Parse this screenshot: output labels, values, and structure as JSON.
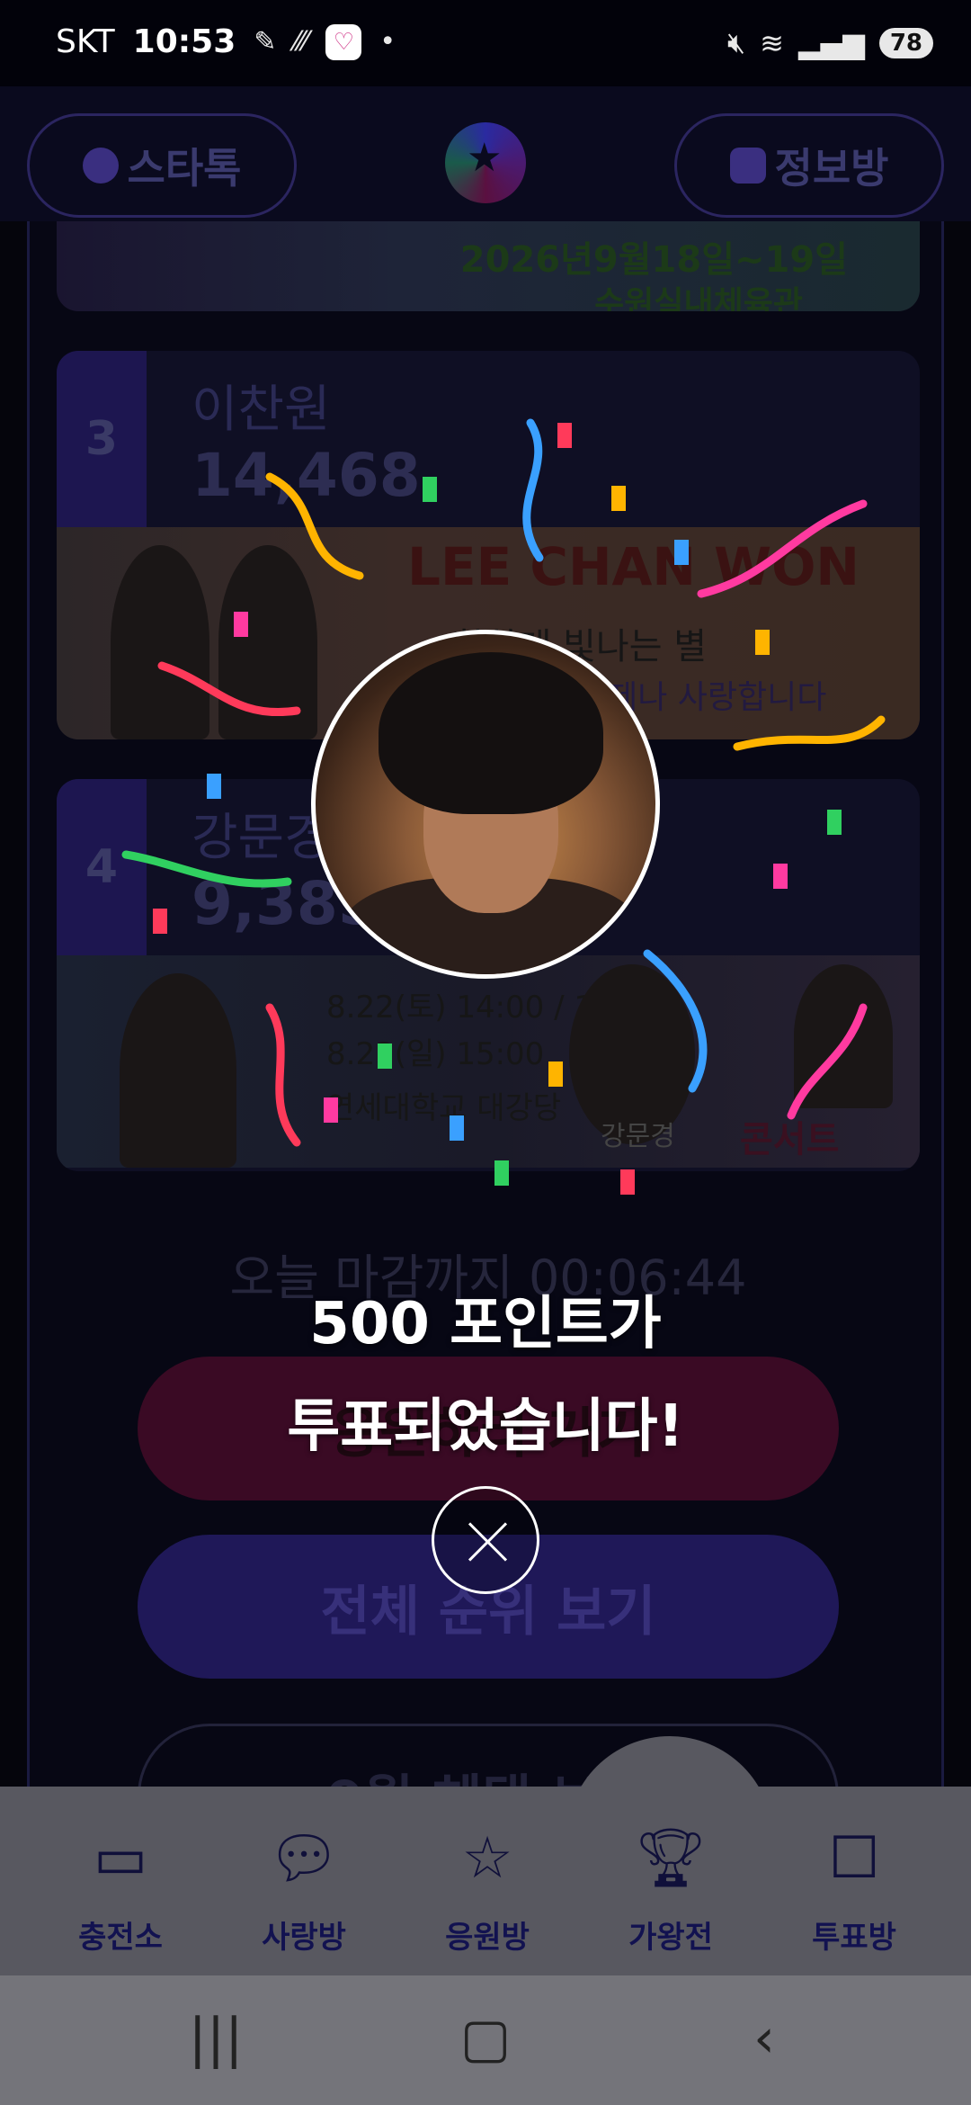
{
  "status": {
    "carrier": "SKT",
    "time": "10:53",
    "battery": "78"
  },
  "header": {
    "left_pill": "스타톡",
    "right_pill": "정보방"
  },
  "top_banner": {
    "dates": "2026년9월18일~19일",
    "venue": "수원실내체육관"
  },
  "rankings": [
    {
      "rank": "3",
      "name": "이찬원",
      "score": "14,468",
      "banner_title": "LEE CHAN WON",
      "banner_line1": "환하게 빛나는 별",
      "banner_line2": "언제나 사랑합니다"
    },
    {
      "rank": "4",
      "name": "강문경",
      "score": "9,385",
      "banner_line1": "8.22(토) 14:00 / 18:30",
      "banner_line2": "8.23(일) 15:00",
      "banner_line3": "연세대학교 대강당",
      "banner_name": "강문경",
      "banner_tag": "콘서트"
    }
  ],
  "deadline": "오늘 마감까지 00:06:44",
  "buttons": {
    "support": "응원하러 가기",
    "ranking": "전체 순위 보기",
    "benefit": "9월 혜택 보기"
  },
  "bottom_nav": [
    {
      "label": "충전소",
      "icon": "battery-icon"
    },
    {
      "label": "사랑방",
      "icon": "chat-icon"
    },
    {
      "label": "응원방",
      "icon": "star-icon"
    },
    {
      "label": "가왕전",
      "icon": "trophy-icon"
    },
    {
      "label": "투표방",
      "icon": "ballot-box-icon"
    }
  ],
  "popup": {
    "line1": "500 포인트가",
    "line2": "투표되었습니다!"
  }
}
